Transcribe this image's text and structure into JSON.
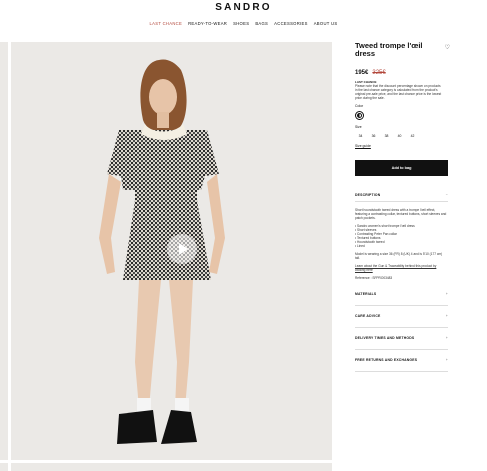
{
  "header": {
    "logo": "SANDRO",
    "nav": [
      "LAST CHANCE",
      "READY-TO-WEAR",
      "SHOES",
      "BAGS",
      "ACCESSORIES",
      "ABOUT US"
    ]
  },
  "product": {
    "title": "Tweed trompe l'œil dress",
    "ref_top": "",
    "price": "195€",
    "old_price": "325€",
    "last_chance_label": "LAST CHANCE",
    "last_chance_text": "Please note that the discount percentage shown on products in the last chance category is calculated from the product's original pre-sale price, and the last chance price is the lowest price during the sale.",
    "color_label": "Color",
    "size_label": "Size",
    "sizes": [
      "34",
      "36",
      "38",
      "40",
      "42"
    ],
    "size_guide": "Size guide",
    "add_to_bag": "Add to bag"
  },
  "description": {
    "heading": "DESCRIPTION",
    "intro": "Short houndstooth tweed dress with a trompe l'œil effect, featuring a contrasting collar, textured buttons, short sleeves and patch pockets.",
    "bullets": [
      "• Sandro women's short trompe l'œil dress",
      "• Short sleeves",
      "• Contrasting Peter Pan collar",
      "• Textured buttons",
      "• Houndstooth tweed",
      "• Lined"
    ],
    "model": "Model is wearing a size 36 (FR) 8 (UK) 4 and is 5'10 (177 cm) tall.",
    "traceability": "Learn about the Gun & Traceability behind this product by clicking here",
    "reference": "Reference : SFPRO03483"
  },
  "accordions": [
    "MATERIALS",
    "CARE ADVICE",
    "DELIVERY TIMES AND METHODS",
    "FREE RETURNS AND EXCHANGES"
  ],
  "icons": {
    "wishlist": "heart-icon",
    "play": "play-icon",
    "collapse": "minus-icon",
    "expand": "plus-icon"
  }
}
